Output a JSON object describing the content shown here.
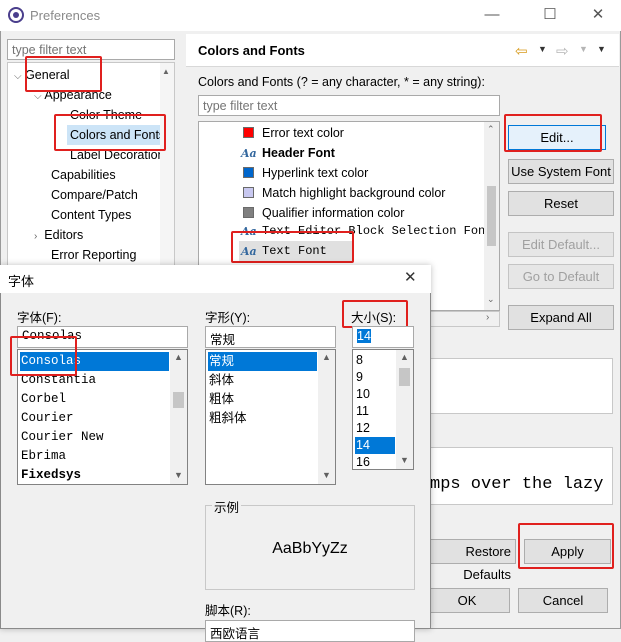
{
  "window": {
    "title": "Preferences"
  },
  "filter": {
    "placeholder": "type filter text"
  },
  "tree": [
    {
      "label": "General"
    },
    {
      "label": "Appearance"
    },
    {
      "label": "Color Theme"
    },
    {
      "label": "Colors and Fonts"
    },
    {
      "label": "Label Decorations"
    },
    {
      "label": "Capabilities"
    },
    {
      "label": "Compare/Patch"
    },
    {
      "label": "Content Types"
    },
    {
      "label": "Editors"
    },
    {
      "label": "Error Reporting"
    }
  ],
  "page": {
    "title": "Colors and Fonts",
    "description": "Colors and Fonts (? = any character, * = any string):",
    "filter_placeholder": "type filter text",
    "items": [
      {
        "label": "Error text color",
        "kind": "color",
        "color": "#ff0000"
      },
      {
        "label": "Header Font",
        "kind": "font",
        "bold": true
      },
      {
        "label": "Hyperlink text color",
        "kind": "color",
        "color": "#0066cc"
      },
      {
        "label": "Match highlight background color",
        "kind": "color",
        "color": "#c8c8f0"
      },
      {
        "label": "Qualifier information color",
        "kind": "color",
        "color": "#808080"
      },
      {
        "label": "Text Editor Block Selection Font",
        "kind": "font",
        "mono": true
      },
      {
        "label": "Text Font",
        "kind": "font",
        "mono": true,
        "selected": true
      }
    ],
    "buttons": {
      "edit": "Edit...",
      "use_system_font": "Use System Font",
      "reset": "Reset",
      "edit_default": "Edit Default...",
      "go_to_default": "Go to Default",
      "expand_all": "Expand All",
      "restore_defaults": "Restore Defaults",
      "apply": "Apply",
      "ok": "OK",
      "cancel": "Cancel"
    },
    "preview_text": "mps over the lazy d"
  },
  "font_dialog": {
    "title": "字体",
    "font_label": "字体(F):",
    "style_label": "字形(Y):",
    "size_label": "大小(S):",
    "font_value": "Consolas",
    "style_value": "常规",
    "size_value": "14",
    "fonts": [
      "Consolas",
      "Constantia",
      "Corbel",
      "Courier",
      "Courier New",
      "Ebrima",
      "Fixedsys"
    ],
    "selected_font_index": 0,
    "styles": [
      "常规",
      "斜体",
      "粗体",
      "粗斜体"
    ],
    "selected_style_index": 0,
    "sizes": [
      "8",
      "9",
      "10",
      "11",
      "12",
      "14",
      "16"
    ],
    "selected_size_index": 5,
    "sample_label": "示例",
    "sample_text": "AaBbYyZz",
    "script_label": "脚本(R):",
    "script_value": "西欧语言"
  }
}
